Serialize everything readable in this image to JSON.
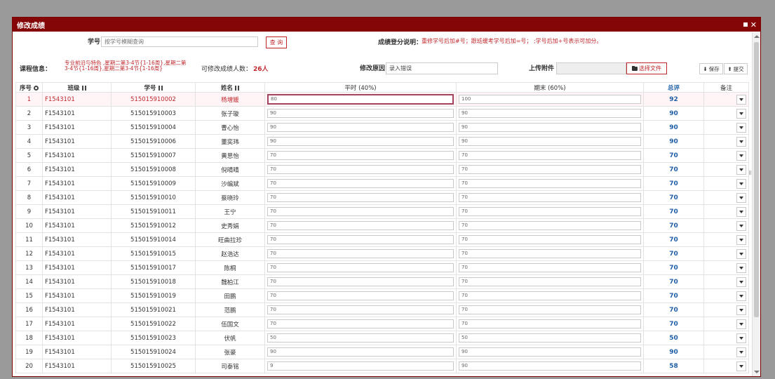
{
  "dialog": {
    "title": "修改成绩"
  },
  "search": {
    "label": "学号",
    "placeholder": "按学号模糊查询",
    "button": "查 询",
    "note_label": "成绩登分说明：",
    "note_text": "重修学号后加#号；跟班缓考学号后加=号； ;学号后加+号表示可加分。"
  },
  "course": {
    "label": "课程信息：",
    "info_line1": "专业前沿与特色 ,星期二第3-4节{1-16周},星期二第",
    "info_line2": "3-4节{1-16周},星期二第3-4节{1-16周}",
    "editable_label": "可修改成绩人数：",
    "editable_count": "26人",
    "reason_label": "修改原因",
    "reason_value": "录入错误",
    "attach_label": "上传附件",
    "choose_file": "选择文件",
    "save": "保存",
    "submit": "提交"
  },
  "table": {
    "headers": [
      "序号",
      "班级",
      "学号",
      "姓名",
      "平时 (40%)",
      "期末 (60%)",
      "总评",
      "备注"
    ],
    "rows": [
      {
        "no": "1",
        "class": "F1543101",
        "id": "515015910002",
        "name": "杨增媛",
        "usual": "80",
        "final": "100",
        "total": "92"
      },
      {
        "no": "2",
        "class": "F1543101",
        "id": "515015910003",
        "name": "张子璇",
        "usual": "90",
        "final": "90",
        "total": "90"
      },
      {
        "no": "3",
        "class": "F1543101",
        "id": "515015910004",
        "name": "曹心怡",
        "usual": "90",
        "final": "90",
        "total": "90"
      },
      {
        "no": "4",
        "class": "F1543101",
        "id": "515015910006",
        "name": "董奕玮",
        "usual": "90",
        "final": "90",
        "total": "90"
      },
      {
        "no": "5",
        "class": "F1543101",
        "id": "515015910007",
        "name": "黄思怡",
        "usual": "70",
        "final": "70",
        "total": "70"
      },
      {
        "no": "6",
        "class": "F1543101",
        "id": "515015910008",
        "name": "倪晴晴",
        "usual": "70",
        "final": "70",
        "total": "70"
      },
      {
        "no": "7",
        "class": "F1543101",
        "id": "515015910009",
        "name": "沙编斌",
        "usual": "70",
        "final": "70",
        "total": "70"
      },
      {
        "no": "8",
        "class": "F1543101",
        "id": "515015910010",
        "name": "蔡晓玲",
        "usual": "70",
        "final": "70",
        "total": "70"
      },
      {
        "no": "9",
        "class": "F1543101",
        "id": "515015910011",
        "name": "王宁",
        "usual": "70",
        "final": "70",
        "total": "70"
      },
      {
        "no": "10",
        "class": "F1543101",
        "id": "515015910012",
        "name": "史秀娟",
        "usual": "70",
        "final": "70",
        "total": "70"
      },
      {
        "no": "11",
        "class": "F1543101",
        "id": "515015910014",
        "name": "旺曲拉珍",
        "usual": "70",
        "final": "70",
        "total": "70"
      },
      {
        "no": "12",
        "class": "F1543101",
        "id": "515015910015",
        "name": "赵浩达",
        "usual": "70",
        "final": "70",
        "total": "70"
      },
      {
        "no": "13",
        "class": "F1543101",
        "id": "515015910017",
        "name": "陈桐",
        "usual": "70",
        "final": "70",
        "total": "70"
      },
      {
        "no": "14",
        "class": "F1543101",
        "id": "515015910018",
        "name": "魏柏江",
        "usual": "70",
        "final": "70",
        "total": "70"
      },
      {
        "no": "15",
        "class": "F1543101",
        "id": "515015910019",
        "name": "田鹏",
        "usual": "70",
        "final": "70",
        "total": "70"
      },
      {
        "no": "16",
        "class": "F1543101",
        "id": "515015910021",
        "name": "范鹏",
        "usual": "70",
        "final": "70",
        "total": "70"
      },
      {
        "no": "17",
        "class": "F1543101",
        "id": "515015910022",
        "name": "伍国文",
        "usual": "70",
        "final": "70",
        "total": "70"
      },
      {
        "no": "18",
        "class": "F1543101",
        "id": "515015910023",
        "name": "伏帆",
        "usual": "50",
        "final": "50",
        "total": "50"
      },
      {
        "no": "19",
        "class": "F1543101",
        "id": "515015910024",
        "name": "张豪",
        "usual": "90",
        "final": "90",
        "total": "90"
      },
      {
        "no": "20",
        "class": "F1543101",
        "id": "515015910025",
        "name": "司泰铭",
        "usual": "9",
        "final": "90",
        "total": "58"
      }
    ]
  }
}
